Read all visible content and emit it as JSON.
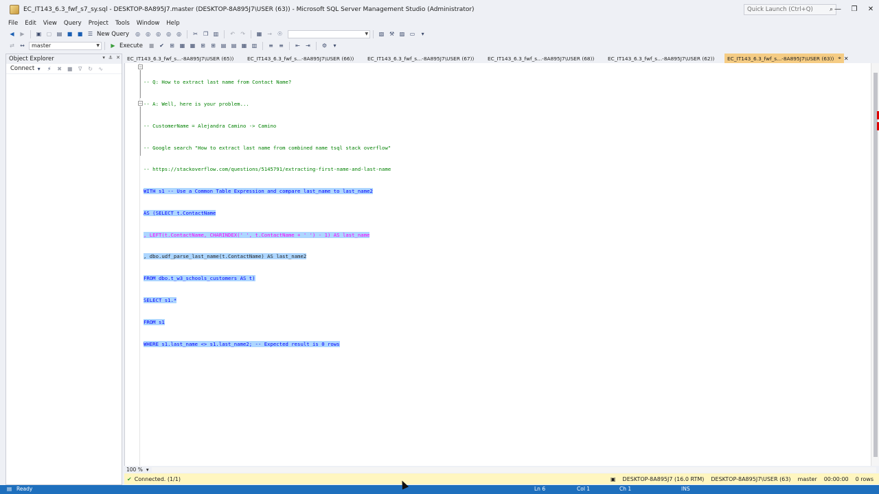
{
  "window": {
    "title": "EC_IT143_6.3_fwf_s7_sy.sql - DESKTOP-8A895J7.master (DESKTOP-8A895J7\\USER (63)) - Microsoft SQL Server Management Studio (Administrator)",
    "quick_launch_placeholder": "Quick Launch (Ctrl+Q)"
  },
  "menu": [
    "File",
    "Edit",
    "View",
    "Query",
    "Project",
    "Tools",
    "Window",
    "Help"
  ],
  "toolbar": {
    "new_query": "New Query",
    "database": "master",
    "execute": "Execute"
  },
  "object_explorer": {
    "title": "Object Explorer",
    "connect": "Connect"
  },
  "tabs": [
    {
      "label": "EC_IT143_6.3_fwf_s...-8A895J7\\USER (65))",
      "active": false
    },
    {
      "label": "EC_IT143_6.3_fwf_s...-8A895J7\\USER (66))",
      "active": false
    },
    {
      "label": "EC_IT143_6.3_fwf_s...-8A895J7\\USER (67))",
      "active": false
    },
    {
      "label": "EC_IT143_6.3_fwf_s...-8A895J7\\USER (68))",
      "active": false
    },
    {
      "label": "EC_IT143_6.3_fwf_s...-8A895J7\\USER (62))",
      "active": false
    },
    {
      "label": "EC_IT143_6.3_fwf_s...-8A895J7\\USER (63))",
      "active": true
    }
  ],
  "code_lines": [
    "-- Q: How to extract last name from Contact Name?",
    "-- A: Well, here is your problem...",
    "-- CustomerName = Alejandra Camino -> Camino",
    "-- Google search \"How to extract last name from combined name tsql stack overflow\"",
    "-- https://stackoverflow.com/questions/5145791/extracting-first-name-and-last-name",
    "WITH s1 -- Use a Common Table Expression and compare last_name to last_name2",
    "AS (SELECT t.ContactName",
    ", LEFT(t.ContactName, CHARINDEX(' ', t.ContactName + ' ') - 1) AS last_name",
    ", dbo.udf_parse_last_name(t.ContactName) AS last_name2",
    "FROM dbo.t_w3_schools_customers AS t)",
    "SELECT s1.*",
    "FROM s1",
    "WHERE s1.last_name <> s1.last_name2; -- Expected result is 0 rows"
  ],
  "editor": {
    "zoom": "100 %"
  },
  "query_status": {
    "connected": "Connected. (1/1)",
    "server": "DESKTOP-8A895J7 (16.0 RTM)",
    "user": "DESKTOP-8A895J7\\USER (63)",
    "database": "master",
    "time": "00:00:00",
    "rows": "0 rows"
  },
  "statusbar": {
    "state": "Ready",
    "ln": "Ln 6",
    "col": "Col 1",
    "ch": "Ch 1",
    "mode": "INS"
  }
}
